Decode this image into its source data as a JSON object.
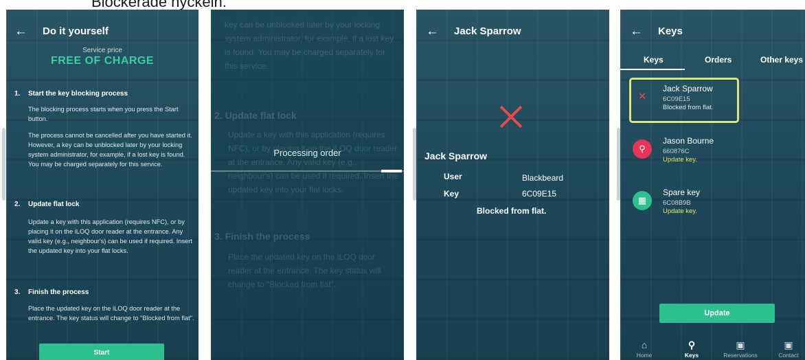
{
  "caption": "Blockerade nyckeln.",
  "screen1": {
    "title": "Do it yourself",
    "service_label": "Service price",
    "service_price": "FREE OF CHARGE",
    "sections": [
      {
        "num": "1.",
        "title": "Start the key blocking process",
        "p1": "The blocking process starts when you press the Start button.",
        "p2": "The process cannot be cancelled after you have started it. However, a key can be unblocked later by your locking system administrator, for example, if a lost key is found. You may be charged separately for this service."
      },
      {
        "num": "2.",
        "title": "Update flat lock",
        "p1": "Update a key with this application (requires NFC), or by placing it on the iLOQ door reader at the entrance. Any valid key (e.g., neighbour's) can be used if required. Insert the updated key into your flat locks."
      },
      {
        "num": "3.",
        "title": "Finish the process",
        "p1": "Place the updated key on the iLOQ door reader at the entrance. The key status will change to \"Blocked from flat\"."
      }
    ],
    "start_button": "Start"
  },
  "screen2": {
    "faded_top": "key can be unblocked later by your locking system administrator, for example, if a lost key is found. You may be charged separately for this service.",
    "faded_head2": "2.   Update flat lock",
    "faded_mid": "Update a key with this application (requires NFC), or by placing it on the iLOQ door reader at the entrance. Any valid key (e.g., neighbour's) can be used if required. Insert the updated key into your flat locks.",
    "faded_head3": "3.   Finish the process",
    "faded_bottom": "Place the updated key on the iLOQ door reader at the entrance. The key status will change to \"Blocked from flat\".",
    "processing": "Processing order",
    "progress": 0.9
  },
  "screen3": {
    "title": "Jack Sparrow",
    "key_name": "Jack Sparrow",
    "user_label": "User",
    "user_value": "Blackbeard",
    "key_label": "Key",
    "key_value": "6C09E15",
    "status": "Blocked from flat."
  },
  "screen4": {
    "title": "Keys",
    "tabs": [
      "Keys",
      "Orders",
      "Other keys"
    ],
    "keys": [
      {
        "name": "Jack Sparrow",
        "code": "6C09E15",
        "status": "Blocked from flat.",
        "color": "#e84a4a",
        "icon": "x-icon"
      },
      {
        "name": "Jason Bourne",
        "code": "660876C",
        "status": "Update key.",
        "color": "#e8345a",
        "icon": "key-icon"
      },
      {
        "name": "Spare key",
        "code": "6C08B9B",
        "status": "Update key.",
        "color": "#2cc08f",
        "icon": "building-icon"
      }
    ],
    "update_button": "Update",
    "nav": [
      "Home",
      "Keys",
      "Reservations",
      "Contact"
    ],
    "highlight_color": "#dfe67a",
    "accent_color": "#2cc08f",
    "status_color": "#e6e45c"
  }
}
